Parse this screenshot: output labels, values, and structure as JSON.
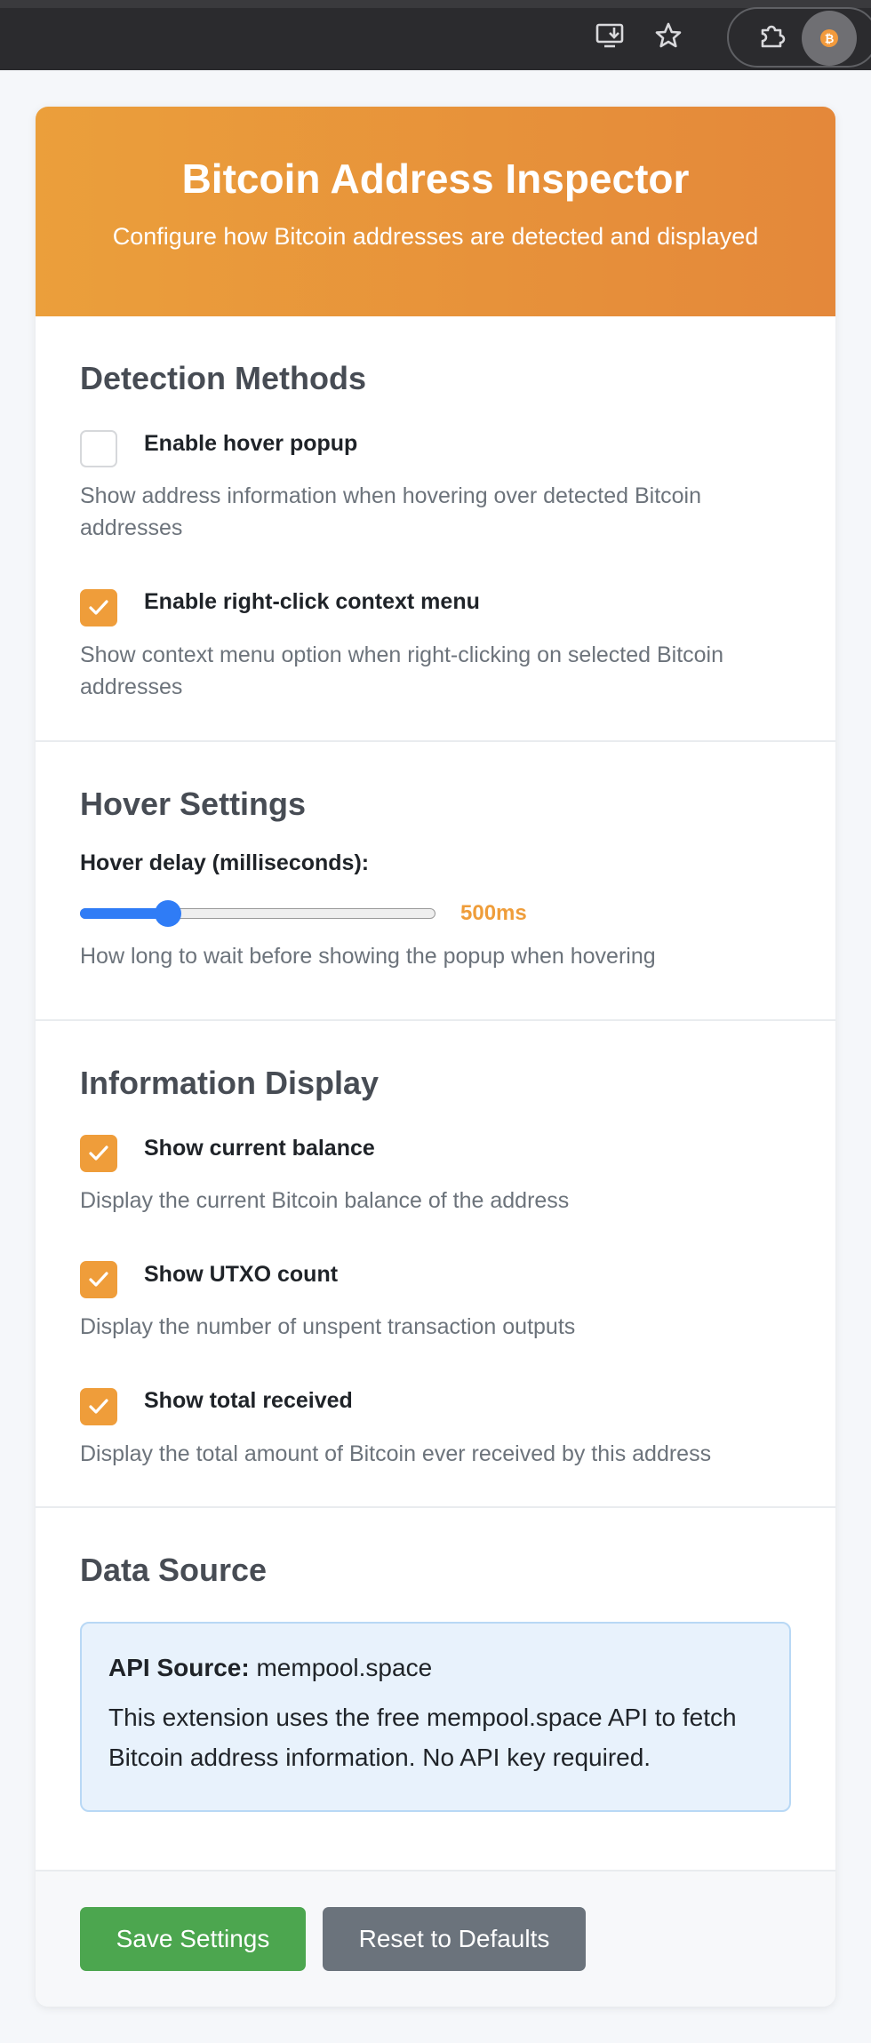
{
  "header": {
    "title": "Bitcoin Address Inspector",
    "subtitle": "Configure how Bitcoin addresses are detected and displayed"
  },
  "detection": {
    "title": "Detection Methods",
    "hover": {
      "label": "Enable hover popup",
      "checked": false,
      "description": "Show address information when hovering over detected Bitcoin addresses"
    },
    "context_menu": {
      "label": "Enable right-click context menu",
      "checked": true,
      "description": "Show context menu option when right-clicking on selected Bitcoin addresses"
    }
  },
  "hover_settings": {
    "title": "Hover Settings",
    "delay_label": "Hover delay (milliseconds):",
    "delay_value": "500ms",
    "delay_fraction": 0.2,
    "description": "How long to wait before showing the popup when hovering"
  },
  "display": {
    "title": "Information Display",
    "balance": {
      "label": "Show current balance",
      "checked": true,
      "description": "Display the current Bitcoin balance of the address"
    },
    "utxo": {
      "label": "Show UTXO count",
      "checked": true,
      "description": "Display the number of unspent transaction outputs"
    },
    "received": {
      "label": "Show total received",
      "checked": true,
      "description": "Display the total amount of Bitcoin ever received by this address"
    }
  },
  "data_source": {
    "title": "Data Source",
    "api_label": "API Source:",
    "api_value": "mempool.space",
    "note": "This extension uses the free mempool.space API to fetch Bitcoin address information. No API key required."
  },
  "footer": {
    "save_label": "Save Settings",
    "reset_label": "Reset to Defaults"
  },
  "colors": {
    "accent": "#ef9d3a",
    "slider": "#2f7cf6",
    "save": "#4ca64f",
    "reset": "#6b737c"
  },
  "toolbar_icons": [
    "install-app-icon",
    "bookmark-star-icon",
    "extensions-puzzle-icon",
    "bitcoin-extension-icon"
  ]
}
